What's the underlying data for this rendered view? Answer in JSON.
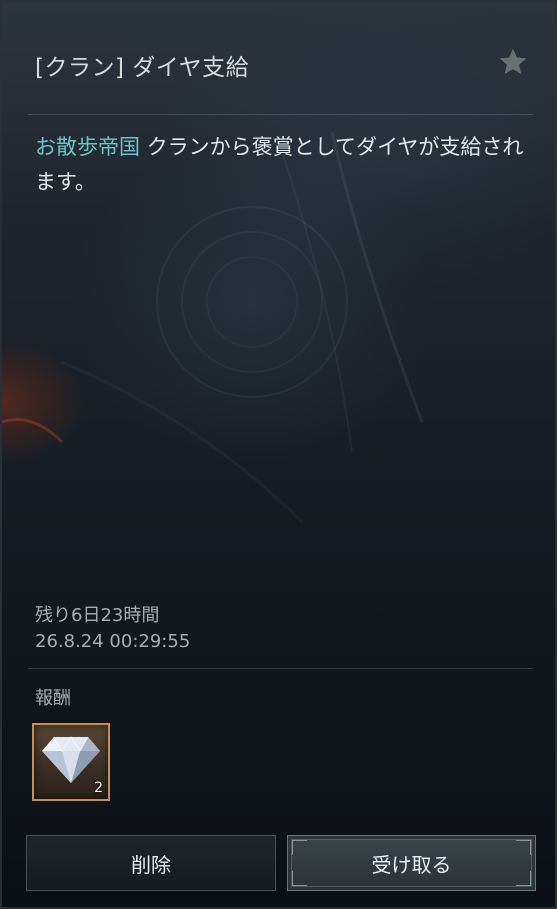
{
  "mail": {
    "title": "[クラン] ダイヤ支給",
    "message_clan": "お散歩帝国",
    "message_text": " クランから褒賞としてダイヤが支給されます。",
    "remaining": "残り6日23時間",
    "date": "26.8.24 00:29:55"
  },
  "reward": {
    "label": "報酬",
    "items": [
      {
        "icon": "diamond-icon",
        "count": "2"
      }
    ]
  },
  "buttons": {
    "delete": "削除",
    "receive": "受け取る"
  },
  "colors": {
    "clan_highlight": "#6fc3c9",
    "reward_border": "#c98e4c"
  }
}
